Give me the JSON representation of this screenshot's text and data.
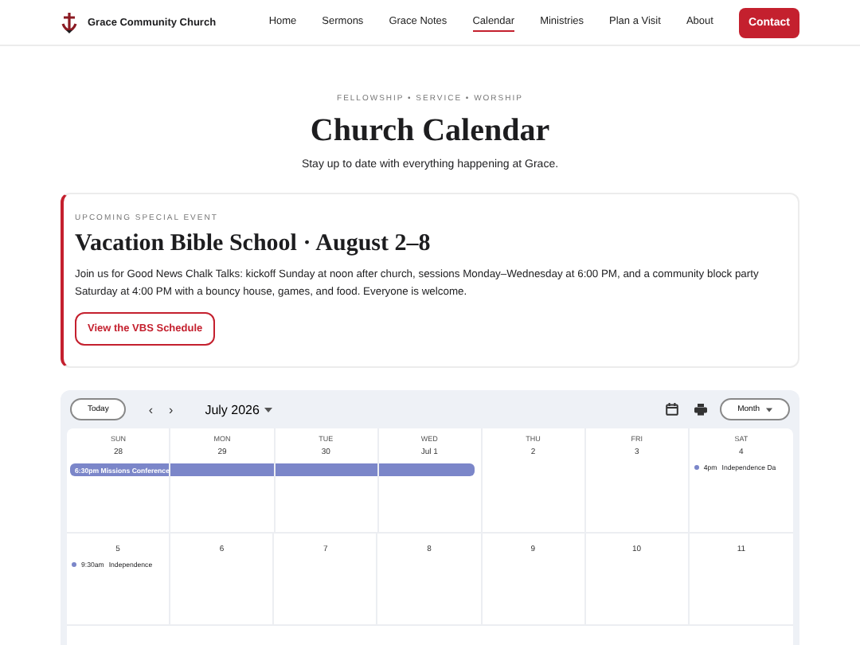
{
  "nav": {
    "brand": "Grace Community Church",
    "links": [
      {
        "label": "Home",
        "selected": false
      },
      {
        "label": "Sermons",
        "selected": false
      },
      {
        "label": "Grace Notes",
        "selected": false
      },
      {
        "label": "Calendar",
        "selected": true
      },
      {
        "label": "Ministries",
        "selected": false
      },
      {
        "label": "Plan a Visit",
        "selected": false
      },
      {
        "label": "About",
        "selected": false
      }
    ],
    "cta": "Contact"
  },
  "header": {
    "tagline": "FELLOWSHIP • SERVICE • WORSHIP",
    "title": "Church Calendar",
    "subtitle": "Stay up to date with everything happening at Grace."
  },
  "special_event": {
    "label": "UPCOMING SPECIAL EVENT",
    "title": "Vacation Bible School · August 2–8",
    "body": "Join us for Good News Chalk Talks: kickoff Sunday at noon after church, sessions Monday–Wednesday at 6:00 PM, and a community block party Saturday at 4:00 PM with a bouncy house, games, and food. Everyone is welcome.",
    "button": "View the VBS Schedule"
  },
  "calendar": {
    "today": "Today",
    "prev": "‹",
    "next": "›",
    "month": "July 2026",
    "view": "Month",
    "weeks": [
      {
        "days": [
          {
            "weekday": "SUN",
            "date": "28",
            "events": [
              {
                "kind": "bar-start",
                "label": "6:30pm Missions Conference",
                "color": "#7b86c9"
              }
            ]
          },
          {
            "weekday": "MON",
            "date": "29",
            "events": [
              {
                "kind": "bar-middle",
                "color": "#7b86c9"
              }
            ]
          },
          {
            "weekday": "TUE",
            "date": "30",
            "events": [
              {
                "kind": "bar-middle",
                "color": "#7b86c9"
              }
            ]
          },
          {
            "weekday": "WED",
            "date": "Jul 1",
            "events": [
              {
                "kind": "bar-end",
                "color": "#7b86c9"
              }
            ]
          },
          {
            "weekday": "THU",
            "date": "2"
          },
          {
            "weekday": "FRI",
            "date": "3"
          },
          {
            "weekday": "SAT",
            "date": "4",
            "events": [
              {
                "kind": "dot",
                "time": "4pm",
                "title": "Independence Da",
                "color": "#7b86c9"
              }
            ]
          }
        ]
      },
      {
        "days": [
          {
            "date": "5",
            "events": [
              {
                "kind": "dot",
                "time": "9:30am",
                "title": "Independence",
                "color": "#7b86c9"
              }
            ]
          },
          {
            "date": "6"
          },
          {
            "date": "7"
          },
          {
            "date": "8"
          },
          {
            "date": "9"
          },
          {
            "date": "10"
          },
          {
            "date": "11"
          }
        ]
      }
    ]
  }
}
